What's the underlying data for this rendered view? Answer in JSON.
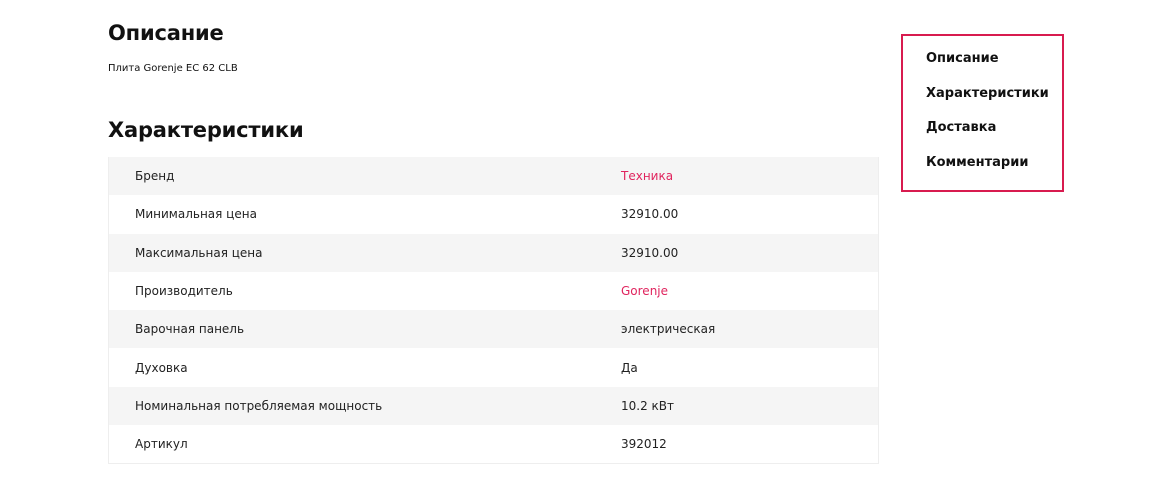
{
  "description": {
    "title": "Описание",
    "text": "Плита Gorenje EC 62 CLB"
  },
  "specifications": {
    "title": "Характеристики",
    "rows": [
      {
        "label": "Бренд",
        "value": "Техника",
        "is_link": true
      },
      {
        "label": "Минимальная цена",
        "value": "32910.00",
        "is_link": false
      },
      {
        "label": "Максимальная цена",
        "value": "32910.00",
        "is_link": false
      },
      {
        "label": "Производитель",
        "value": "Gorenje",
        "is_link": true
      },
      {
        "label": "Варочная панель",
        "value": "электрическая",
        "is_link": false
      },
      {
        "label": "Духовка",
        "value": "Да",
        "is_link": false
      },
      {
        "label": "Номинальная потребляемая мощность",
        "value": "10.2 кВт",
        "is_link": false
      },
      {
        "label": "Артикул",
        "value": "392012",
        "is_link": false
      }
    ]
  },
  "side_nav": {
    "items": [
      {
        "label": "Описание"
      },
      {
        "label": "Характеристики"
      },
      {
        "label": "Доставка"
      },
      {
        "label": "Комментарии"
      }
    ]
  },
  "colors": {
    "accent": "#e0245e",
    "nav_border": "#d81b4f",
    "row_stripe": "#f5f5f5"
  }
}
